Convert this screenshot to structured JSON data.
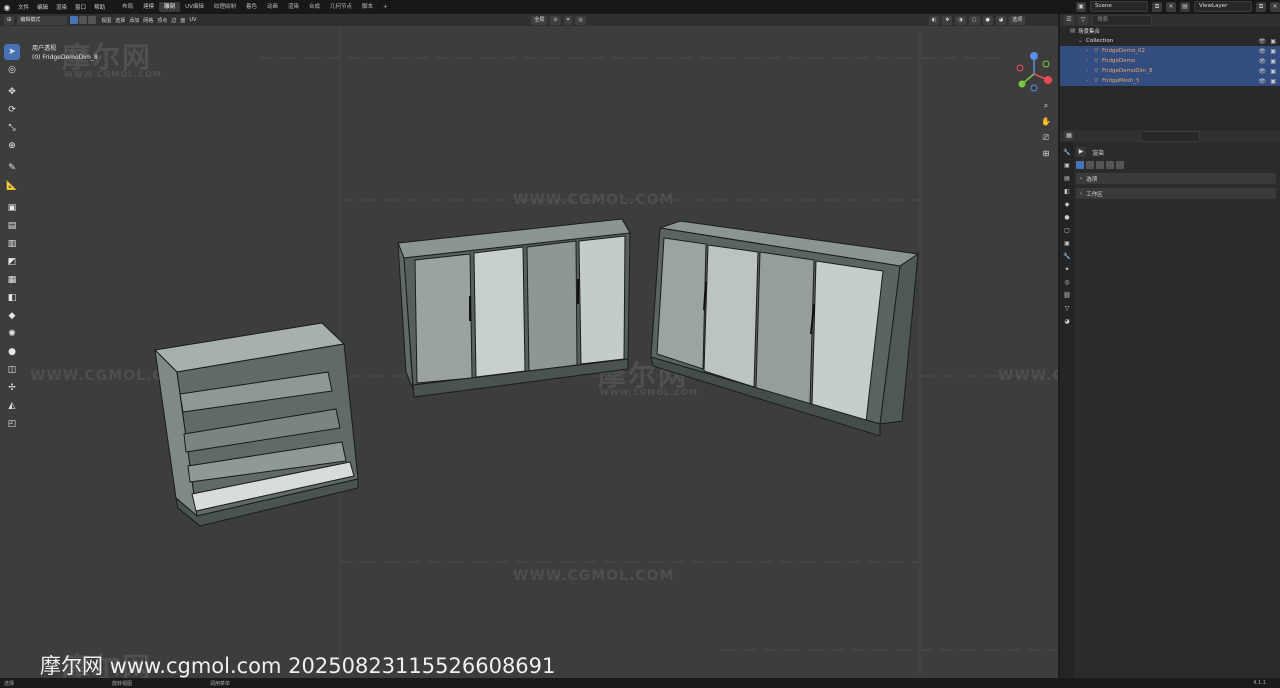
{
  "menu": {
    "app_icon": "blender-logo-icon",
    "items": [
      "文件",
      "编辑",
      "渲染",
      "窗口",
      "帮助"
    ],
    "workspaces": [
      "布局",
      "建模",
      "雕刻",
      "UV编辑",
      "纹理绘制",
      "着色",
      "动画",
      "渲染",
      "合成",
      "几何节点",
      "脚本"
    ],
    "active_workspace": "雕刻",
    "add_tab": "+"
  },
  "scene": {
    "scene_name": "Scene",
    "view_layer": "ViewLayer",
    "search_placeholder": "搜索"
  },
  "viewport": {
    "mode": "编辑模式",
    "header_menus": [
      "视图",
      "选择",
      "添加",
      "网格",
      "顶点",
      "边",
      "面",
      "UV"
    ],
    "transform_orientation": "全局",
    "options_label": "选项",
    "view_name": "用户透视",
    "object_info": "(0) FridgeDemoDim_8"
  },
  "outliner": {
    "scene_collection": "场景集合",
    "collection": "Collection",
    "objects": [
      "FridgeDemo_02",
      "FridgeDemo",
      "FridgeDemoDim_8",
      "FridgeMesh_5"
    ]
  },
  "properties": {
    "search_placeholder": "",
    "title": "渲染",
    "panels": [
      "选项",
      "工作区"
    ]
  },
  "watermark": {
    "logo": "摩尔网",
    "url": "WWW.CGMOL.COM",
    "url_lower": "www.cgmol.com",
    "stamp": "摩尔网 www.cgmol.com 20250823115526608691"
  },
  "status": {
    "items": [
      "选择",
      "旋转视图",
      "调用菜单"
    ],
    "version": "4.1.1"
  }
}
